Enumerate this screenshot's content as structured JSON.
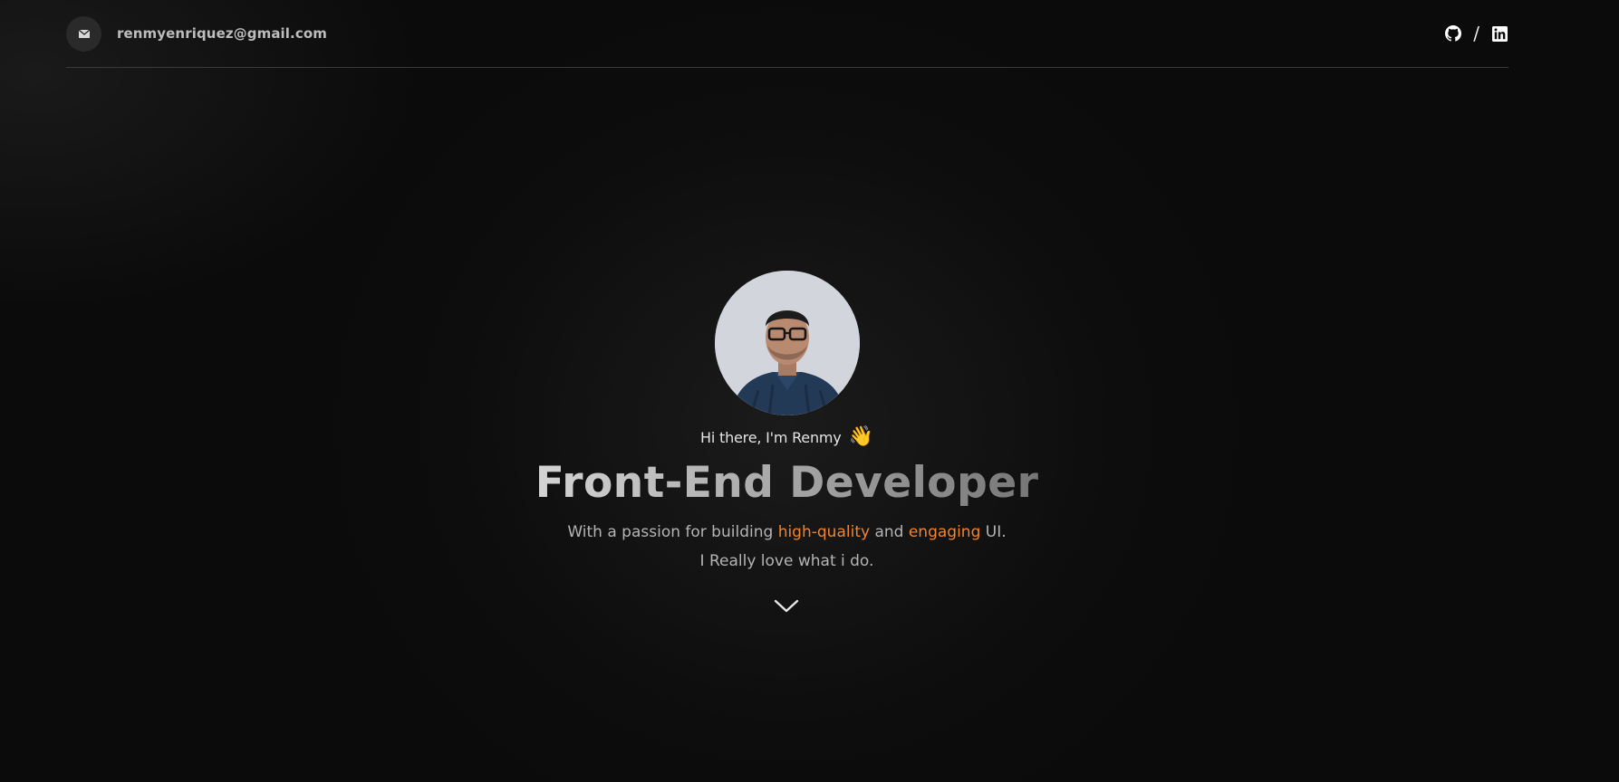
{
  "header": {
    "email": "renmyenriquez@gmail.com",
    "mail_icon": "mail-icon",
    "separator": "/",
    "socials": [
      {
        "name": "GitHub",
        "icon": "github-icon"
      },
      {
        "name": "LinkedIn",
        "icon": "linkedin-icon"
      }
    ]
  },
  "hero": {
    "greeting": "Hi there, I'm Renmy",
    "wave": "👋",
    "title": "Front-End Developer",
    "tagline": {
      "prefix": "With a passion for building ",
      "accent1": "high-quality",
      "middle": " and ",
      "accent2": "engaging",
      "suffix": " UI."
    },
    "subline": "I Really love what i do.",
    "scroll_icon": "chevron-down-icon"
  },
  "colors": {
    "background": "#0b0b0b",
    "accent": "#f0852d",
    "text_muted": "#b4b4b4",
    "divider": "#3a3a3a"
  }
}
